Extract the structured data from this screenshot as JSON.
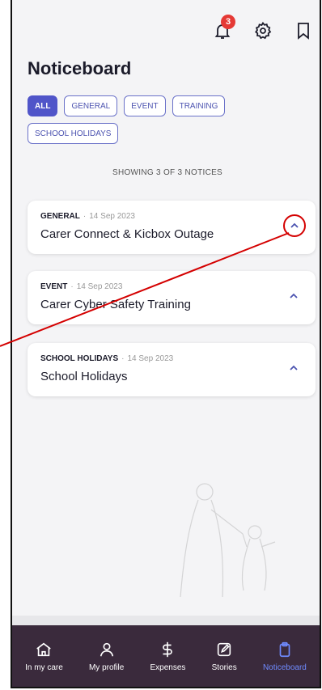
{
  "header": {
    "notification_count": "3",
    "title": "Noticeboard"
  },
  "filters": [
    "ALL",
    "GENERAL",
    "EVENT",
    "TRAINING",
    "SCHOOL HOLIDAYS"
  ],
  "showing": "SHOWING 3 OF 3 NOTICES",
  "notices": [
    {
      "category": "GENERAL",
      "separator": "·",
      "date": "14 Sep 2023",
      "title": "Carer Connect & Kicbox Outage"
    },
    {
      "category": "EVENT",
      "separator": "·",
      "date": "14 Sep 2023",
      "title": "Carer Cyber Safety Training"
    },
    {
      "category": "SCHOOL HOLIDAYS",
      "separator": "·",
      "date": "14 Sep 2023",
      "title": "School Holidays"
    }
  ],
  "nav": [
    {
      "label": "In my care",
      "icon": "home-icon"
    },
    {
      "label": "My profile",
      "icon": "user-icon"
    },
    {
      "label": "Expenses",
      "icon": "dollar-icon"
    },
    {
      "label": "Stories",
      "icon": "edit-icon"
    },
    {
      "label": "Noticeboard",
      "icon": "clipboard-icon"
    }
  ],
  "colors": {
    "accent": "#5055c9",
    "nav_bg": "#3a2a3c",
    "nav_active": "#6f8bff",
    "badge": "#e53935",
    "annotation": "#d40000"
  }
}
